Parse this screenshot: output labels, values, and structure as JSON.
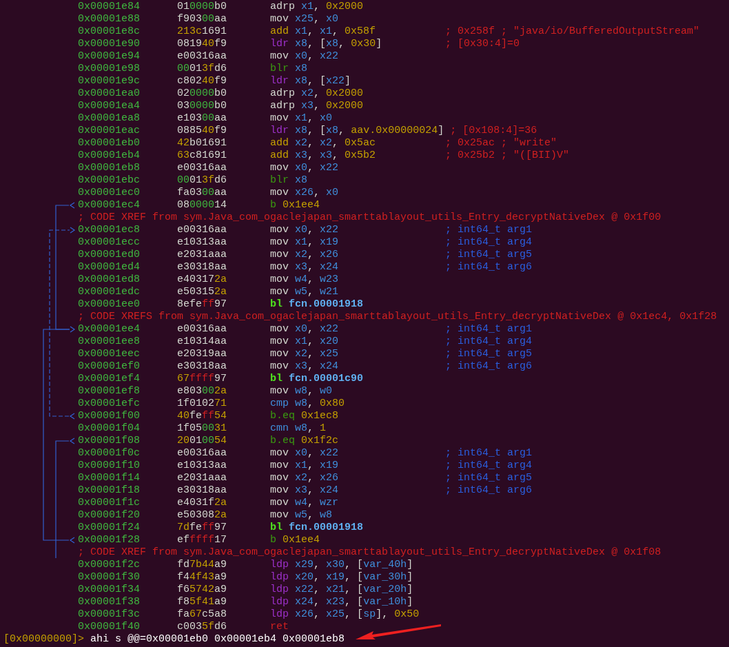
{
  "listing": [
    {
      "kind": "insn",
      "address": "0x00001e84",
      "bytes": "010000b0",
      "mnemonic": {
        "text": "adrp",
        "kind": "plain"
      },
      "operands": "x1, 0x2000"
    },
    {
      "kind": "insn",
      "address": "0x00001e88",
      "bytes": "f90300aa",
      "mnemonic": {
        "text": "mov",
        "kind": "plain"
      },
      "operands": "x25, x0"
    },
    {
      "kind": "insn",
      "address": "0x00001e8c",
      "bytes": "213c1691",
      "mnemonic": {
        "text": "add",
        "kind": "arith"
      },
      "operands": "x1, x1, 0x58f",
      "comment": {
        "text": "; 0x258f ; \"java/io/BufferedOutputStream\"",
        "kind": "info"
      }
    },
    {
      "kind": "insn",
      "address": "0x00001e90",
      "bytes": "081940f9",
      "mnemonic": {
        "text": "ldr",
        "kind": "load"
      },
      "operands": "x8, [x8, 0x30]",
      "comment": {
        "text": "; [0x30:4]=0",
        "kind": "info"
      }
    },
    {
      "kind": "insn",
      "address": "0x00001e94",
      "bytes": "e00316aa",
      "mnemonic": {
        "text": "mov",
        "kind": "plain"
      },
      "operands": "x0, x22"
    },
    {
      "kind": "insn",
      "address": "0x00001e98",
      "bytes": "00013fd6",
      "mnemonic": {
        "text": "blr",
        "kind": "call"
      },
      "operands": "x8"
    },
    {
      "kind": "insn",
      "address": "0x00001e9c",
      "bytes": "c80240f9",
      "mnemonic": {
        "text": "ldr",
        "kind": "load"
      },
      "operands": "x8, [x22]"
    },
    {
      "kind": "insn",
      "address": "0x00001ea0",
      "bytes": "020000b0",
      "mnemonic": {
        "text": "adrp",
        "kind": "plain"
      },
      "operands": "x2, 0x2000"
    },
    {
      "kind": "insn",
      "address": "0x00001ea4",
      "bytes": "030000b0",
      "mnemonic": {
        "text": "adrp",
        "kind": "plain"
      },
      "operands": "x3, 0x2000"
    },
    {
      "kind": "insn",
      "address": "0x00001ea8",
      "bytes": "e10300aa",
      "mnemonic": {
        "text": "mov",
        "kind": "plain"
      },
      "operands": "x1, x0"
    },
    {
      "kind": "insn",
      "address": "0x00001eac",
      "bytes": "088540f9",
      "mnemonic": {
        "text": "ldr",
        "kind": "load"
      },
      "operands": "x8, [x8, aav.0x00000024]",
      "comment": {
        "text": "; [0x108:4]=36",
        "kind": "info"
      }
    },
    {
      "kind": "insn",
      "address": "0x00001eb0",
      "bytes": "42b01691",
      "mnemonic": {
        "text": "add",
        "kind": "arith"
      },
      "operands": "x2, x2, 0x5ac",
      "comment": {
        "text": "; 0x25ac ; \"write\"",
        "kind": "info"
      }
    },
    {
      "kind": "insn",
      "address": "0x00001eb4",
      "bytes": "63c81691",
      "mnemonic": {
        "text": "add",
        "kind": "arith"
      },
      "operands": "x3, x3, 0x5b2",
      "comment": {
        "text": "; 0x25b2 ; \"([BII)V\"",
        "kind": "info"
      }
    },
    {
      "kind": "insn",
      "address": "0x00001eb8",
      "bytes": "e00316aa",
      "mnemonic": {
        "text": "mov",
        "kind": "plain"
      },
      "operands": "x0, x22"
    },
    {
      "kind": "insn",
      "address": "0x00001ebc",
      "bytes": "00013fd6",
      "mnemonic": {
        "text": "blr",
        "kind": "call"
      },
      "operands": "x8"
    },
    {
      "kind": "insn",
      "address": "0x00001ec0",
      "bytes": "fa0300aa",
      "mnemonic": {
        "text": "mov",
        "kind": "plain"
      },
      "operands": "x26, x0"
    },
    {
      "kind": "insn",
      "address": "0x00001ec4",
      "bytes": "08000014",
      "mnemonic": {
        "text": "b",
        "kind": "jump"
      },
      "operands": "0x1ee4"
    },
    {
      "kind": "xref",
      "text": "; CODE XREF from sym.Java_com_ogaclejapan_smarttablayout_utils_Entry_decryptNativeDex @ 0x1f00"
    },
    {
      "kind": "insn",
      "address": "0x00001ec8",
      "bytes": "e00316aa",
      "mnemonic": {
        "text": "mov",
        "kind": "plain"
      },
      "operands": "x0, x22",
      "comment": {
        "text": "; int64_t arg1",
        "kind": "arg"
      }
    },
    {
      "kind": "insn",
      "address": "0x00001ecc",
      "bytes": "e10313aa",
      "mnemonic": {
        "text": "mov",
        "kind": "plain"
      },
      "operands": "x1, x19",
      "comment": {
        "text": "; int64_t arg4",
        "kind": "arg"
      }
    },
    {
      "kind": "insn",
      "address": "0x00001ed0",
      "bytes": "e2031aaa",
      "mnemonic": {
        "text": "mov",
        "kind": "plain"
      },
      "operands": "x2, x26",
      "comment": {
        "text": "; int64_t arg5",
        "kind": "arg"
      }
    },
    {
      "kind": "insn",
      "address": "0x00001ed4",
      "bytes": "e30318aa",
      "mnemonic": {
        "text": "mov",
        "kind": "plain"
      },
      "operands": "x3, x24",
      "comment": {
        "text": "; int64_t arg6",
        "kind": "arg"
      }
    },
    {
      "kind": "insn",
      "address": "0x00001ed8",
      "bytes": "e403172a",
      "mnemonic": {
        "text": "mov",
        "kind": "plain"
      },
      "operands": "w4, w23"
    },
    {
      "kind": "insn",
      "address": "0x00001edc",
      "bytes": "e503152a",
      "mnemonic": {
        "text": "mov",
        "kind": "plain"
      },
      "operands": "w5, w21"
    },
    {
      "kind": "insn",
      "address": "0x00001ee0",
      "bytes": "8efeff97",
      "mnemonic": {
        "text": "bl",
        "kind": "direct_call"
      },
      "operands": "fcn.00001918"
    },
    {
      "kind": "xref",
      "text": "; CODE XREFS from sym.Java_com_ogaclejapan_smarttablayout_utils_Entry_decryptNativeDex @ 0x1ec4, 0x1f28"
    },
    {
      "kind": "insn",
      "address": "0x00001ee4",
      "bytes": "e00316aa",
      "mnemonic": {
        "text": "mov",
        "kind": "plain"
      },
      "operands": "x0, x22",
      "comment": {
        "text": "; int64_t arg1",
        "kind": "arg"
      }
    },
    {
      "kind": "insn",
      "address": "0x00001ee8",
      "bytes": "e10314aa",
      "mnemonic": {
        "text": "mov",
        "kind": "plain"
      },
      "operands": "x1, x20",
      "comment": {
        "text": "; int64_t arg4",
        "kind": "arg"
      }
    },
    {
      "kind": "insn",
      "address": "0x00001eec",
      "bytes": "e20319aa",
      "mnemonic": {
        "text": "mov",
        "kind": "plain"
      },
      "operands": "x2, x25",
      "comment": {
        "text": "; int64_t arg5",
        "kind": "arg"
      }
    },
    {
      "kind": "insn",
      "address": "0x00001ef0",
      "bytes": "e30318aa",
      "mnemonic": {
        "text": "mov",
        "kind": "plain"
      },
      "operands": "x3, x24",
      "comment": {
        "text": "; int64_t arg6",
        "kind": "arg"
      }
    },
    {
      "kind": "insn",
      "address": "0x00001ef4",
      "bytes": "67ffff97",
      "mnemonic": {
        "text": "bl",
        "kind": "direct_call"
      },
      "operands": "fcn.00001c90"
    },
    {
      "kind": "insn",
      "address": "0x00001ef8",
      "bytes": "e803002a",
      "mnemonic": {
        "text": "mov",
        "kind": "plain"
      },
      "operands": "w8, w0"
    },
    {
      "kind": "insn",
      "address": "0x00001efc",
      "bytes": "1f010271",
      "mnemonic": {
        "text": "cmp",
        "kind": "compare"
      },
      "operands": "w8, 0x80"
    },
    {
      "kind": "insn",
      "address": "0x00001f00",
      "bytes": "40feff54",
      "mnemonic": {
        "text": "b.eq",
        "kind": "jump"
      },
      "operands": "0x1ec8"
    },
    {
      "kind": "insn",
      "address": "0x00001f04",
      "bytes": "1f050031",
      "mnemonic": {
        "text": "cmn",
        "kind": "compare"
      },
      "operands": "w8, 1"
    },
    {
      "kind": "insn",
      "address": "0x00001f08",
      "bytes": "20010054",
      "mnemonic": {
        "text": "b.eq",
        "kind": "jump"
      },
      "operands": "0x1f2c"
    },
    {
      "kind": "insn",
      "address": "0x00001f0c",
      "bytes": "e00316aa",
      "mnemonic": {
        "text": "mov",
        "kind": "plain"
      },
      "operands": "x0, x22",
      "comment": {
        "text": "; int64_t arg1",
        "kind": "arg"
      }
    },
    {
      "kind": "insn",
      "address": "0x00001f10",
      "bytes": "e10313aa",
      "mnemonic": {
        "text": "mov",
        "kind": "plain"
      },
      "operands": "x1, x19",
      "comment": {
        "text": "; int64_t arg4",
        "kind": "arg"
      }
    },
    {
      "kind": "insn",
      "address": "0x00001f14",
      "bytes": "e2031aaa",
      "mnemonic": {
        "text": "mov",
        "kind": "plain"
      },
      "operands": "x2, x26",
      "comment": {
        "text": "; int64_t arg5",
        "kind": "arg"
      }
    },
    {
      "kind": "insn",
      "address": "0x00001f18",
      "bytes": "e30318aa",
      "mnemonic": {
        "text": "mov",
        "kind": "plain"
      },
      "operands": "x3, x24",
      "comment": {
        "text": "; int64_t arg6",
        "kind": "arg"
      }
    },
    {
      "kind": "insn",
      "address": "0x00001f1c",
      "bytes": "e4031f2a",
      "mnemonic": {
        "text": "mov",
        "kind": "plain"
      },
      "operands": "w4, wzr"
    },
    {
      "kind": "insn",
      "address": "0x00001f20",
      "bytes": "e503082a",
      "mnemonic": {
        "text": "mov",
        "kind": "plain"
      },
      "operands": "w5, w8"
    },
    {
      "kind": "insn",
      "address": "0x00001f24",
      "bytes": "7dfeff97",
      "mnemonic": {
        "text": "bl",
        "kind": "direct_call"
      },
      "operands": "fcn.00001918"
    },
    {
      "kind": "insn",
      "address": "0x00001f28",
      "bytes": "efffff17",
      "mnemonic": {
        "text": "b",
        "kind": "jump"
      },
      "operands": "0x1ee4"
    },
    {
      "kind": "xref",
      "text": "; CODE XREF from sym.Java_com_ogaclejapan_smarttablayout_utils_Entry_decryptNativeDex @ 0x1f08"
    },
    {
      "kind": "insn",
      "address": "0x00001f2c",
      "bytes": "fd7b44a9",
      "mnemonic": {
        "text": "ldp",
        "kind": "load"
      },
      "operands": "x29, x30, [var_40h]"
    },
    {
      "kind": "insn",
      "address": "0x00001f30",
      "bytes": "f44f43a9",
      "mnemonic": {
        "text": "ldp",
        "kind": "load"
      },
      "operands": "x20, x19, [var_30h]"
    },
    {
      "kind": "insn",
      "address": "0x00001f34",
      "bytes": "f65742a9",
      "mnemonic": {
        "text": "ldp",
        "kind": "load"
      },
      "operands": "x22, x21, [var_20h]"
    },
    {
      "kind": "insn",
      "address": "0x00001f38",
      "bytes": "f85f41a9",
      "mnemonic": {
        "text": "ldp",
        "kind": "load"
      },
      "operands": "x24, x23, [var_10h]"
    },
    {
      "kind": "insn",
      "address": "0x00001f3c",
      "bytes": "fa67c5a8",
      "mnemonic": {
        "text": "ldp",
        "kind": "load"
      },
      "operands": "x26, x25, [sp], 0x50"
    },
    {
      "kind": "insn",
      "address": "0x00001f40",
      "bytes": "c0035fd6",
      "mnemonic": {
        "text": "ret",
        "kind": "return"
      }
    }
  ],
  "prompt": {
    "prefix": "[0x00000000]>",
    "command": "ahi s @@=0x00001eb0 0x00001eb4 0x00001eb8"
  }
}
